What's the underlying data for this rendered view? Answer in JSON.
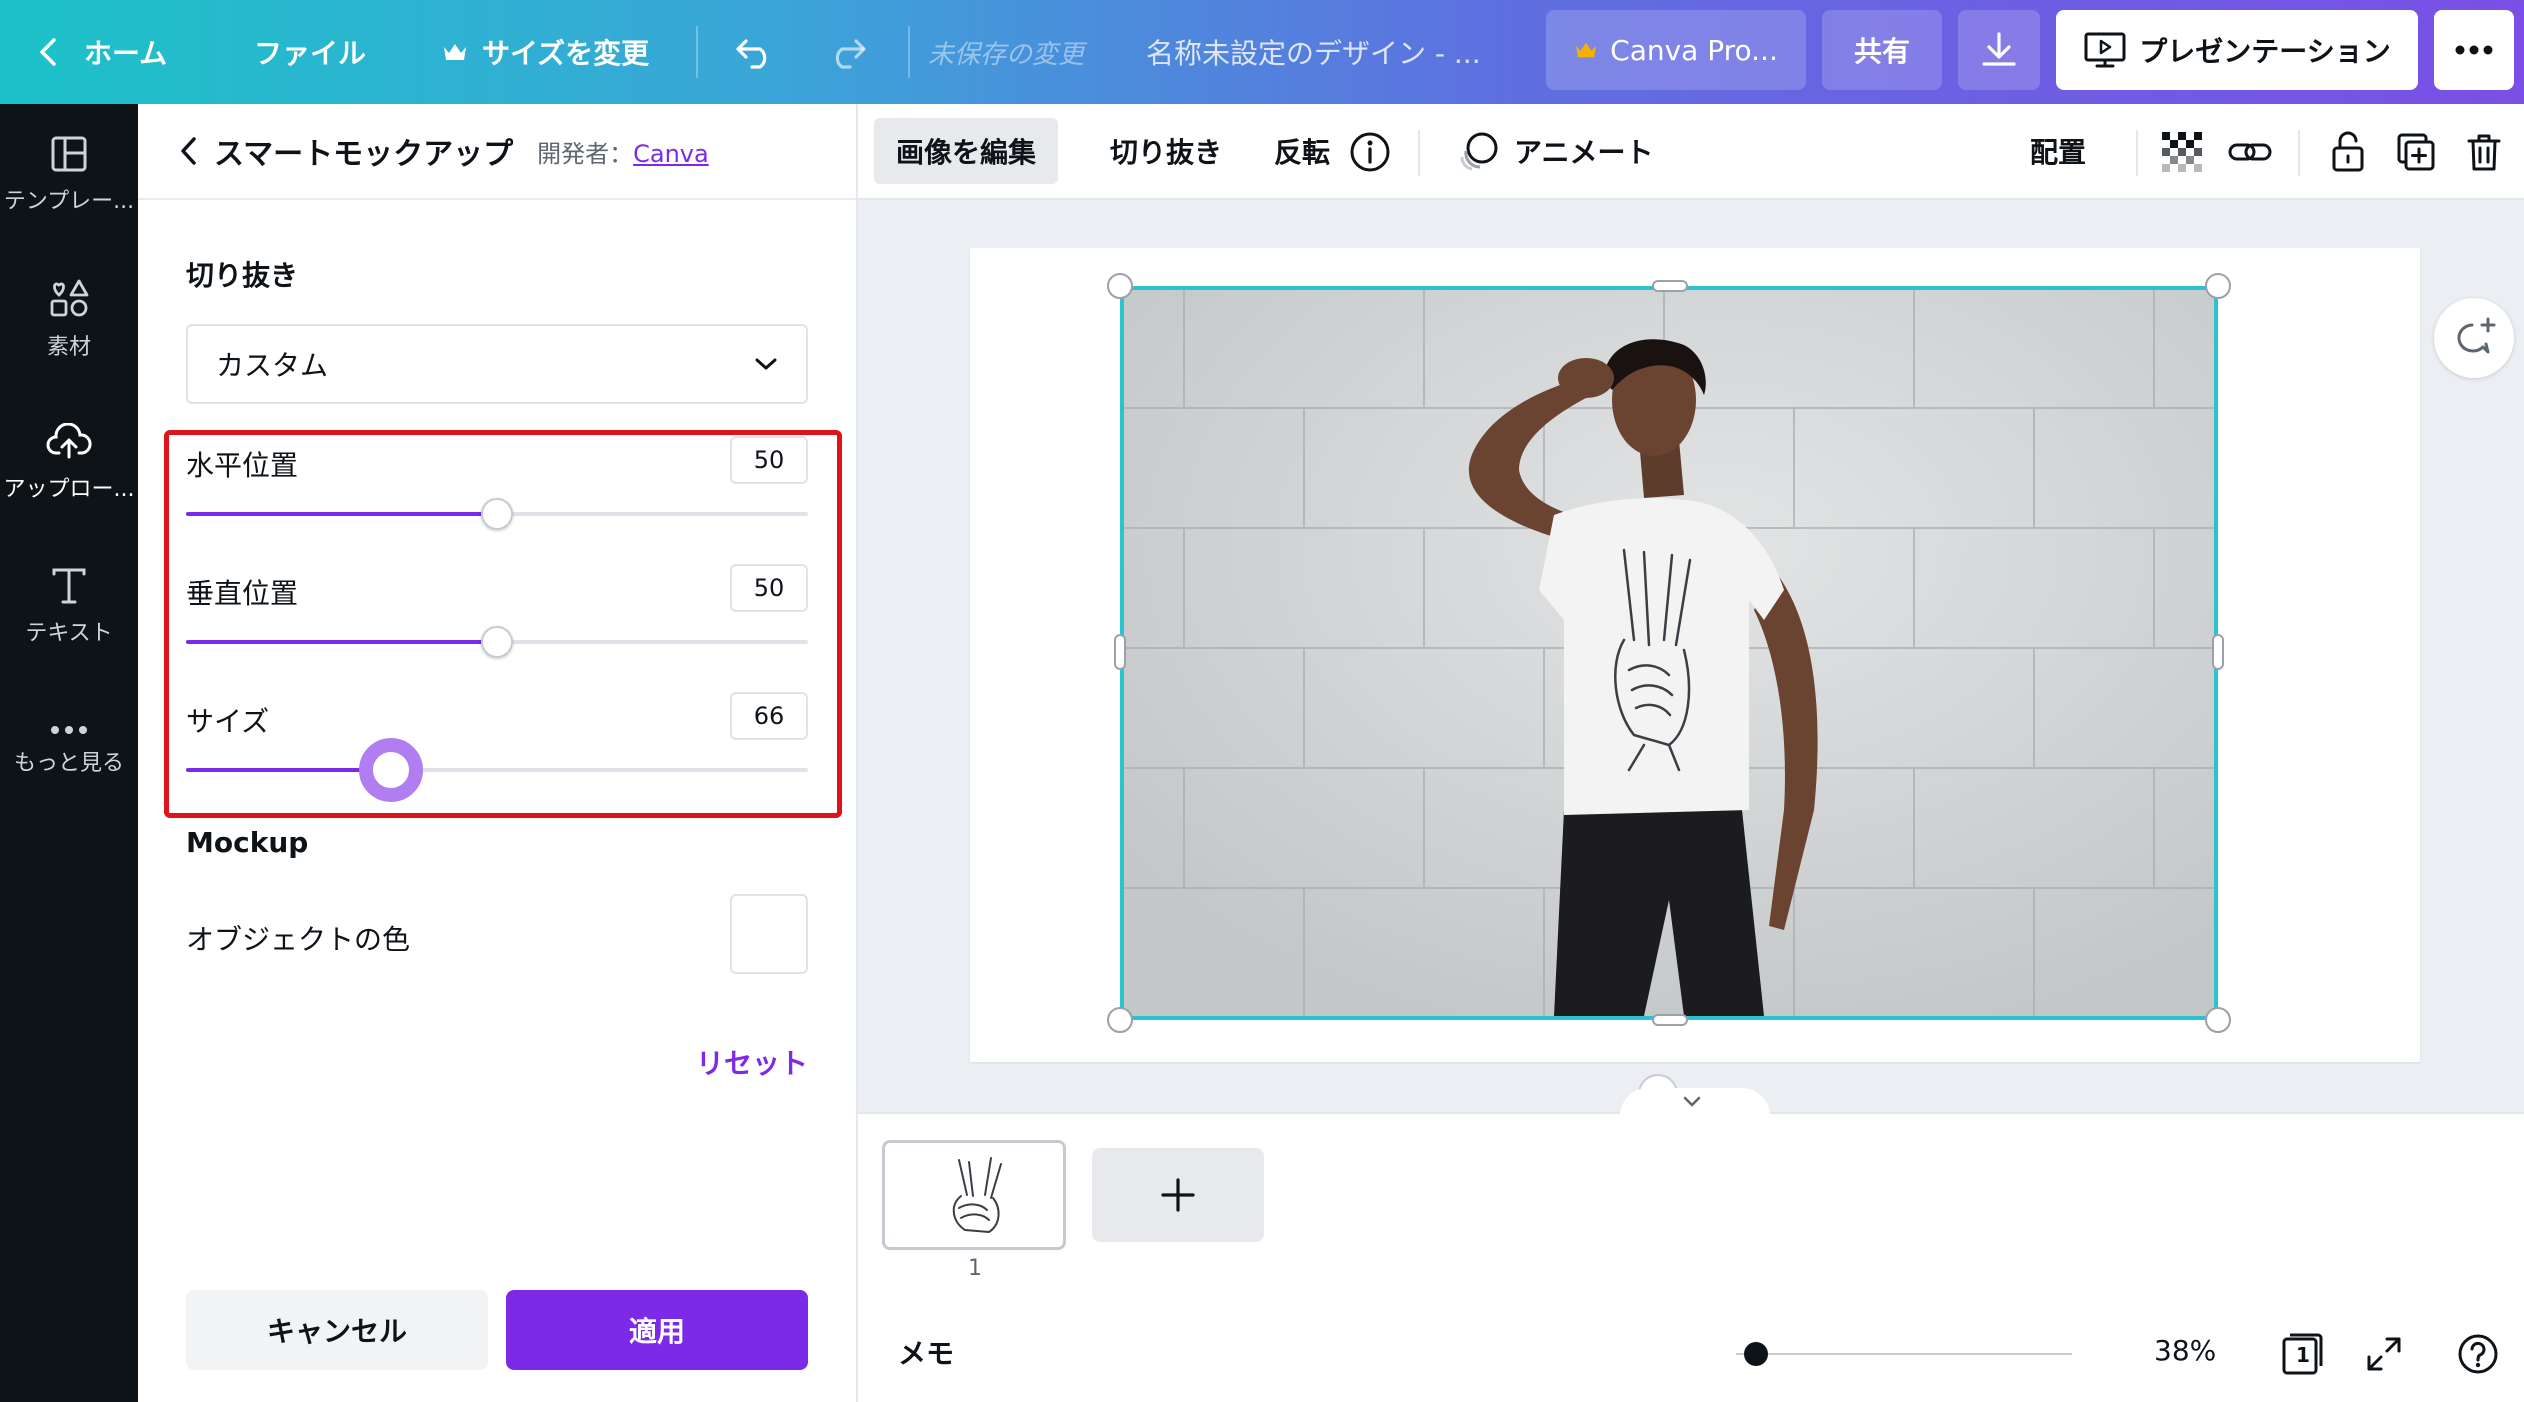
{
  "topbar": {
    "home": "ホーム",
    "file": "ファイル",
    "resize": "サイズを変更",
    "unsaved": "未保存の変更",
    "doc_title": "名称未設定のデザイン - ...",
    "pro": "Canva Pro...",
    "share": "共有",
    "present": "プレゼンテーション"
  },
  "rail": {
    "items": [
      {
        "label": "テンプレー...",
        "icon": "template-icon"
      },
      {
        "label": "素材",
        "icon": "elements-icon"
      },
      {
        "label": "アップロー...",
        "icon": "upload-icon"
      },
      {
        "label": "テキスト",
        "icon": "text-icon"
      },
      {
        "label": "もっと見る",
        "icon": "more-icon"
      }
    ]
  },
  "panel": {
    "title": "スマートモックアップ",
    "developer_prefix": "開発者：",
    "developer": "Canva",
    "crop_section": "切り抜き",
    "crop_select": "カスタム",
    "sliders": [
      {
        "label": "水平位置",
        "value": "50",
        "percent": 50
      },
      {
        "label": "垂直位置",
        "value": "50",
        "percent": 50
      },
      {
        "label": "サイズ",
        "value": "66",
        "percent": 33
      }
    ],
    "mockup_section": "Mockup",
    "object_color_label": "オブジェクトの色",
    "object_color": "#ffffff",
    "reset": "リセット",
    "cancel": "キャンセル",
    "apply": "適用"
  },
  "toolbar": {
    "edit_image": "画像を編集",
    "crop": "切り抜き",
    "flip": "反転",
    "animate": "アニメート",
    "position": "配置"
  },
  "pages": {
    "page_number": "1"
  },
  "footer": {
    "memo": "メモ",
    "zoom": "38%",
    "page_count": "1"
  },
  "colors": {
    "accent": "#7d2ae8",
    "selection": "#2ac3d0",
    "highlight": "#e0121a"
  }
}
